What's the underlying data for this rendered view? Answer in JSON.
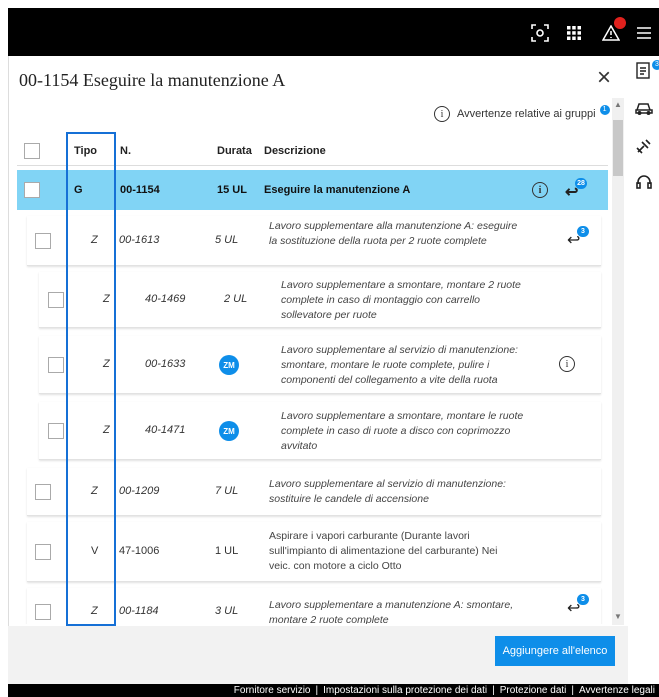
{
  "topbar": {
    "icons": [
      "scan-icon",
      "grid-apps-icon",
      "warning-triangle-icon",
      "hamburger-menu-icon"
    ],
    "alert_color": "#e0211d"
  },
  "rail": {
    "icons": [
      "checklist-icon",
      "car-icon",
      "tools-icon",
      "headset-icon"
    ],
    "checklist_badge": "3"
  },
  "dialog": {
    "title": "00-1154 Eseguire la manutenzione A",
    "close_symbol": "×",
    "warning_label": "Avvertenze relative ai gruppi",
    "warning_badge": "1"
  },
  "table": {
    "headers": {
      "tipo": "Tipo",
      "num": "N.",
      "durata": "Durata",
      "descrizione": "Descrizione"
    },
    "rows": [
      {
        "tipo": "G",
        "num": "00-1154",
        "durata": "15 UL",
        "desc": "Eseguire la manutenzione A",
        "badge": "28"
      },
      {
        "tipo": "Z",
        "num": "00-1613",
        "durata": "5 UL",
        "desc": "Lavoro supplementare alla manutenzione A: eseguire la sostituzione della ruota per 2 ruote complete",
        "badge": "3"
      },
      {
        "tipo": "Z",
        "num": "40-1469",
        "durata": "2 UL",
        "desc": "Lavoro supplementare a smontare, montare 2 ruote complete in caso di montaggio con carrello sollevatore per ruote"
      },
      {
        "tipo": "Z",
        "num": "00-1633",
        "durata": "ZM",
        "desc": "Lavoro supplementare al servizio di manutenzione: smontare, montare le ruote complete, pulire i componenti del collegamento a vite della ruota"
      },
      {
        "tipo": "Z",
        "num": "40-1471",
        "durata": "ZM",
        "desc": "Lavoro supplementare a smontare, montare le ruote complete in caso di ruote a disco con coprimozzo avvitato"
      },
      {
        "tipo": "Z",
        "num": "00-1209",
        "durata": "7 UL",
        "desc": "Lavoro supplementare al servizio di manutenzione: sostituire le candele di accensione"
      },
      {
        "tipo": "V",
        "num": "47-1006",
        "durata": "1 UL",
        "desc": "Aspirare i vapori carburante (Durante lavori sull'impianto di alimentazione del carburante) Nei veic. con motore a ciclo Otto"
      },
      {
        "tipo": "Z",
        "num": "00-1184",
        "durata": "3 UL",
        "desc": "Lavoro supplementare a manutenzione A: smontare, montare 2 ruote complete",
        "badge": "3"
      }
    ]
  },
  "actions": {
    "add_label": "Aggiungere all'elenco"
  },
  "footer": {
    "links": [
      "Fornitore servizio",
      "Impostazioni sulla protezione dei dati",
      "Protezione dati",
      "Avvertenze legali"
    ],
    "separator": "|"
  },
  "colors": {
    "accent": "#0e8ee9",
    "selected_row": "#81d4f5",
    "highlight_box": "#1570d6"
  }
}
